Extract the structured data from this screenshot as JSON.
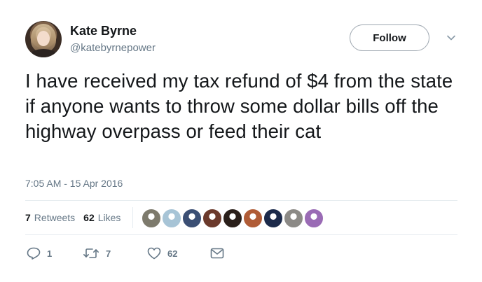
{
  "user": {
    "name": "Kate Byrne",
    "handle": "@katebyrnepower"
  },
  "header": {
    "follow_label": "Follow"
  },
  "tweet": {
    "text": "I have received my tax refund of $4 from the state if anyone wants to throw some dollar bills off the highway overpass or feed their cat",
    "timestamp": "7:05 AM - 15 Apr 2016"
  },
  "stats": {
    "retweets_count": "7",
    "retweets_label": "Retweets",
    "likes_count": "62",
    "likes_label": "Likes"
  },
  "likers": [
    {
      "color": "#7d7a6c"
    },
    {
      "color": "#a7c4d6"
    },
    {
      "color": "#3b4f74"
    },
    {
      "color": "#6b3a2c"
    },
    {
      "color": "#2a1f1a"
    },
    {
      "color": "#b05c36"
    },
    {
      "color": "#1c2a4a"
    },
    {
      "color": "#8c8a86"
    },
    {
      "color": "#9a6bb5"
    }
  ],
  "actions": {
    "reply_count": "1",
    "retweet_count": "7",
    "like_count": "62"
  },
  "colors": {
    "text": "#14171a",
    "secondary": "#657786",
    "divider": "#e6ecf0"
  }
}
